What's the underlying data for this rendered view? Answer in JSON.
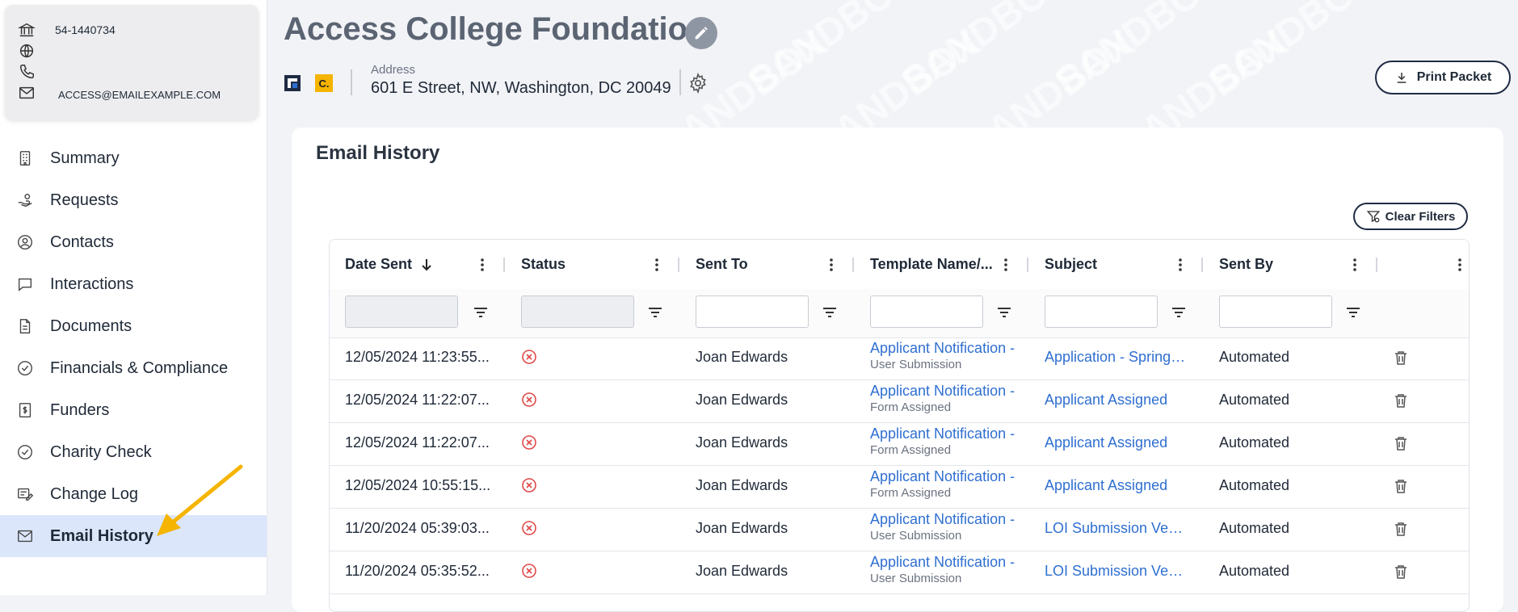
{
  "org": {
    "tax_id": "54-1440734",
    "email": "ACCESS@EMAILEXAMPLE.COM",
    "name": "Access College Foundation",
    "address_label": "Address",
    "address": "601 E Street, NW, Washington, DC 20049",
    "logo2_text": "C."
  },
  "header": {
    "print_label": "Print Packet",
    "watermark": "SANDBOX"
  },
  "nav": [
    {
      "label": "Summary",
      "icon": "building-icon",
      "active": false
    },
    {
      "label": "Requests",
      "icon": "hand-icon",
      "active": false
    },
    {
      "label": "Contacts",
      "icon": "user-circle-icon",
      "active": false
    },
    {
      "label": "Interactions",
      "icon": "chat-icon",
      "active": false
    },
    {
      "label": "Documents",
      "icon": "document-icon",
      "active": false
    },
    {
      "label": "Financials & Compliance",
      "icon": "check-circle-icon",
      "active": false
    },
    {
      "label": "Funders",
      "icon": "dollar-icon",
      "active": false
    },
    {
      "label": "Charity Check",
      "icon": "check-circle-icon",
      "active": false
    },
    {
      "label": "Change Log",
      "icon": "changelog-icon",
      "active": false
    },
    {
      "label": "Email History",
      "icon": "mail-icon",
      "active": true
    }
  ],
  "email_history": {
    "title": "Email History",
    "clear_filters": "Clear Filters",
    "columns": [
      "Date Sent",
      "Status",
      "Sent To",
      "Template Name/...",
      "Subject",
      "Sent By",
      ""
    ],
    "rows": [
      {
        "date": "12/05/2024 11:23:55...",
        "status": "failed",
        "sent_to": "Joan Edwards",
        "template": "Applicant Notification -",
        "template_sub": "User Submission",
        "subject": "Application - Spring ...",
        "sent_by": "Automated"
      },
      {
        "date": "12/05/2024 11:22:07...",
        "status": "failed",
        "sent_to": "Joan Edwards",
        "template": "Applicant Notification -",
        "template_sub": "Form Assigned",
        "subject": "Applicant Assigned",
        "sent_by": "Automated"
      },
      {
        "date": "12/05/2024 11:22:07...",
        "status": "failed",
        "sent_to": "Joan Edwards",
        "template": "Applicant Notification -",
        "template_sub": "Form Assigned",
        "subject": "Applicant Assigned",
        "sent_by": "Automated"
      },
      {
        "date": "12/05/2024 10:55:15...",
        "status": "failed",
        "sent_to": "Joan Edwards",
        "template": "Applicant Notification -",
        "template_sub": "Form Assigned",
        "subject": "Applicant Assigned",
        "sent_by": "Automated"
      },
      {
        "date": "11/20/2024 05:39:03...",
        "status": "failed",
        "sent_to": "Joan Edwards",
        "template": "Applicant Notification -",
        "template_sub": "User Submission",
        "subject": "LOI Submission Veri...",
        "sent_by": "Automated"
      },
      {
        "date": "11/20/2024 05:35:52...",
        "status": "failed",
        "sent_to": "Joan Edwards",
        "template": "Applicant Notification -",
        "template_sub": "User Submission",
        "subject": "LOI Submission Veri...",
        "sent_by": "Automated"
      }
    ]
  },
  "colors": {
    "accent": "#2f6fd1",
    "active_nav_bg": "#dbe6fb",
    "error_red": "#e04848",
    "annotation_arrow": "#f5b400"
  }
}
